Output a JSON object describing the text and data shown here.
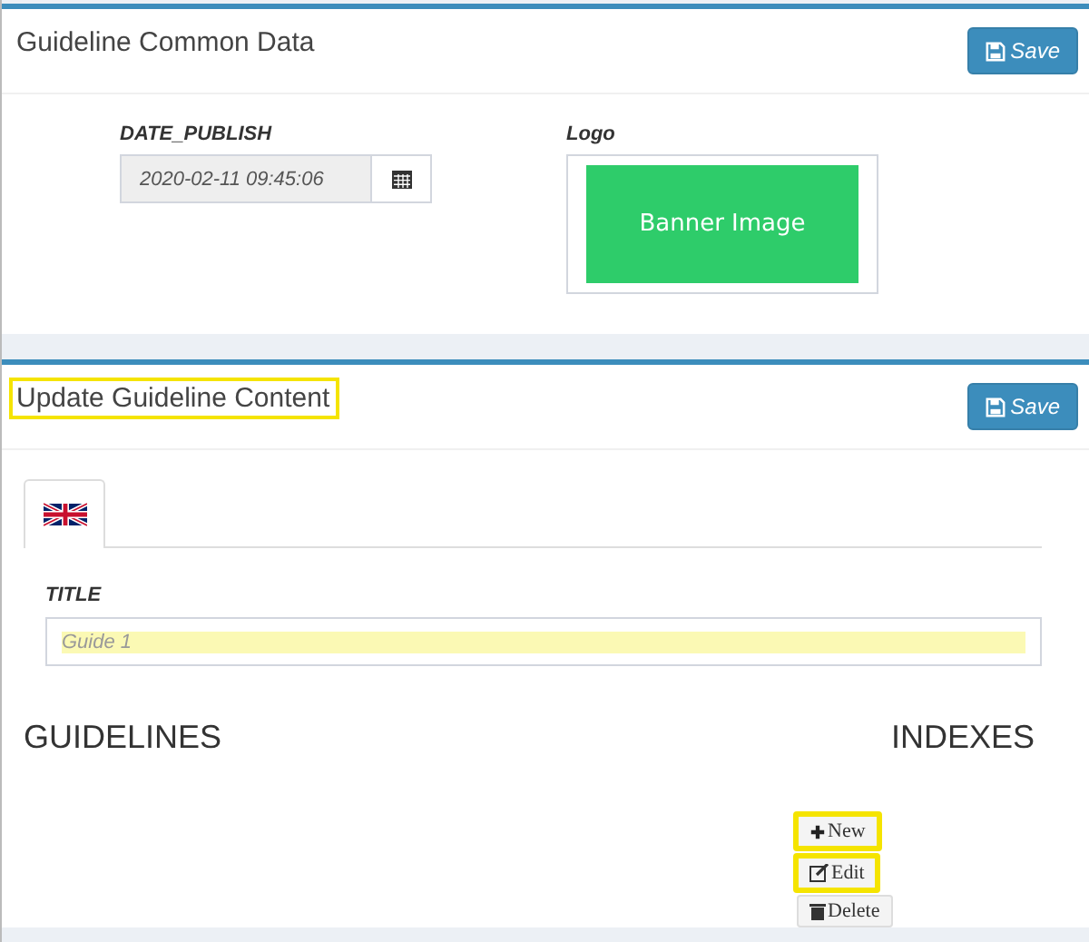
{
  "panels": [
    {
      "title": "Guideline Common Data",
      "title_highlighted": false,
      "save_label": "Save",
      "date": {
        "label": "DATE_PUBLISH",
        "value": "2020-02-11 09:45:06",
        "disabled": true
      },
      "logo": {
        "label": "Logo",
        "banner_text": "Banner Image"
      }
    },
    {
      "title": "Update Guideline Content",
      "title_highlighted": true,
      "save_label": "Save",
      "tabs": [
        {
          "kind": "uk-flag",
          "selected": true
        }
      ],
      "title_field": {
        "label": "TITLE",
        "placeholder": "Guide 1",
        "highlighted": true
      },
      "guidelines_heading": "GUIDELINES",
      "indexes_heading": "INDEXES",
      "index_buttons": [
        {
          "kind": "new",
          "label": "New",
          "highlighted": true
        },
        {
          "kind": "edit",
          "label": "Edit",
          "highlighted": true
        },
        {
          "kind": "delete",
          "label": "Delete",
          "highlighted": false
        }
      ]
    }
  ]
}
